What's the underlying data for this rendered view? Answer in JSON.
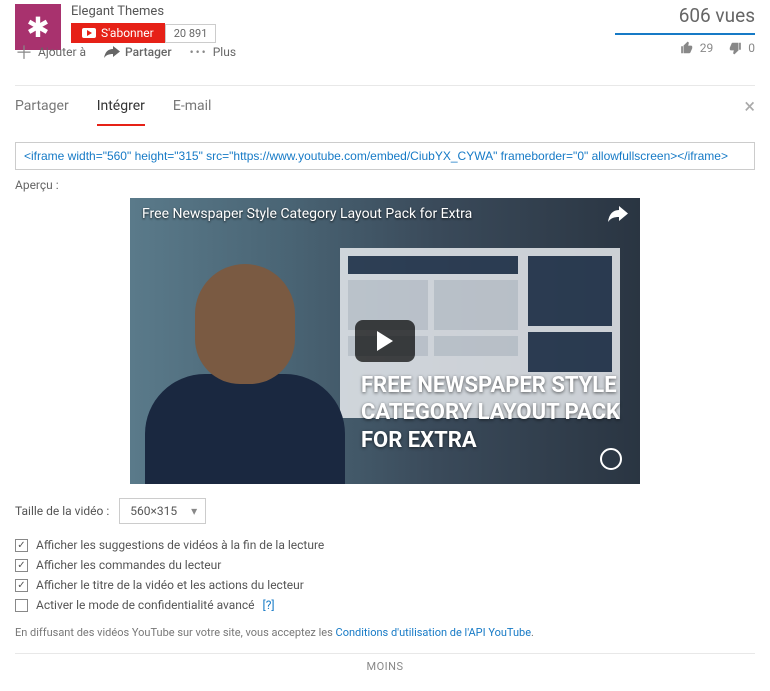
{
  "channel": {
    "name": "Elegant Themes",
    "subscribe_label": "S'abonner",
    "sub_count": "20 891"
  },
  "stats": {
    "views": "606 vues",
    "likes": "29",
    "dislikes": "0"
  },
  "actions": {
    "add": "Ajouter à",
    "share": "Partager",
    "more": "Plus"
  },
  "tabs": {
    "share": "Partager",
    "embed": "Intégrer",
    "email": "E-mail"
  },
  "embed_code": "<iframe width=\"560\" height=\"315\" src=\"https://www.youtube.com/embed/CiubYX_CYWA\" frameborder=\"0\" allowfullscreen></iframe>",
  "preview_label": "Aperçu :",
  "video": {
    "title": "Free Newspaper Style Category Layout Pack for Extra",
    "overlay_l1": "FREE NEWSPAPER STYLE",
    "overlay_l2": "CATEGORY LAYOUT PACK",
    "overlay_l3": "FOR EXTRA"
  },
  "size": {
    "label": "Taille de la vidéo :",
    "value": "560×315"
  },
  "options": {
    "o1": "Afficher les suggestions de vidéos à la fin de la lecture",
    "o2": "Afficher les commandes du lecteur",
    "o3": "Afficher le titre de la vidéo et les actions du lecteur",
    "o4": "Activer le mode de confidentialité avancé"
  },
  "help_mark": "[?]",
  "terms_prefix": "En diffusant des vidéos YouTube sur votre site, vous acceptez les ",
  "terms_link": "Conditions d'utilisation de l'API YouTube",
  "less": "MOINS",
  "checks": {
    "o1": true,
    "o2": true,
    "o3": true,
    "o4": false
  }
}
